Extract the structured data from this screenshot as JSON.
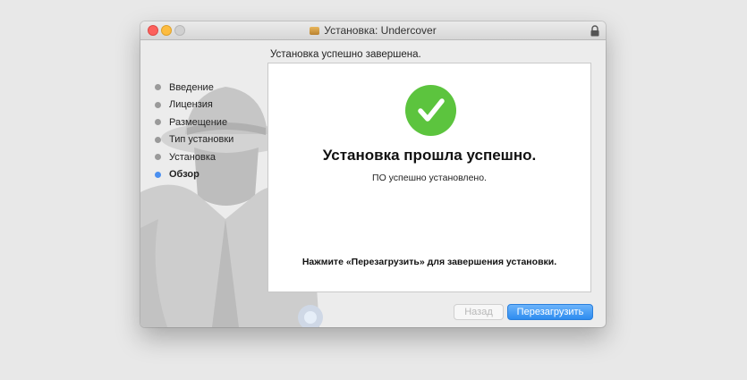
{
  "window": {
    "title": "Установка: Undercover"
  },
  "sidebar": {
    "steps": [
      {
        "label": "Введение",
        "active": false
      },
      {
        "label": "Лицензия",
        "active": false
      },
      {
        "label": "Размещение",
        "active": false
      },
      {
        "label": "Тип установки",
        "active": false
      },
      {
        "label": "Установка",
        "active": false
      },
      {
        "label": "Обзор",
        "active": true
      }
    ]
  },
  "main": {
    "header": "Установка успешно завершена.",
    "heading": "Установка прошла успешно.",
    "subtitle": "ПО успешно установлено.",
    "instruction": "Нажмите «Перезагрузить» для завершения установки."
  },
  "buttons": {
    "back_label": "Назад",
    "restart_label": "Перезагрузить"
  },
  "colors": {
    "accent": "#2d8cf0",
    "success": "#5cc43e",
    "active_step": "#4a8ff0"
  }
}
